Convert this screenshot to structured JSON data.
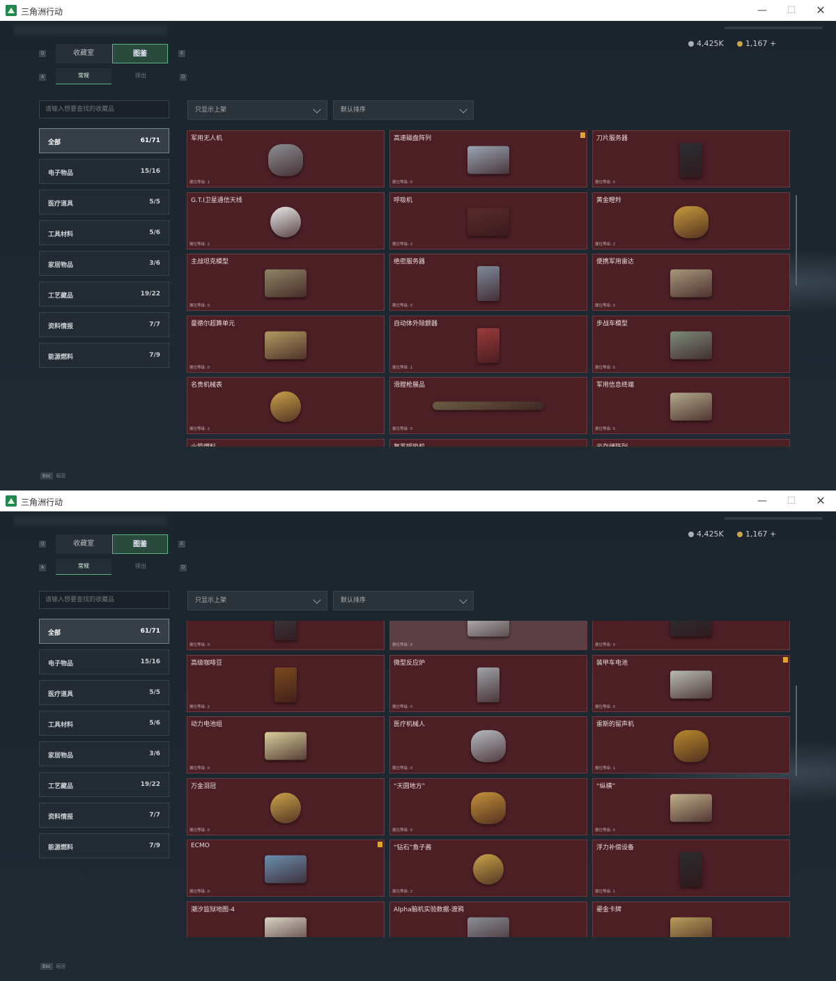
{
  "windows": [
    {
      "title": "三角洲行动",
      "controls": {
        "minimize": "—",
        "maximize": "☐",
        "close": "✕"
      },
      "currency": {
        "silver": "4,425K",
        "gold": "1,167 +"
      },
      "tabs": [
        "收藏室",
        "图鉴"
      ],
      "subtabs": [
        "常规",
        "排出"
      ],
      "search_placeholder": "请输入想要查找的收藏品",
      "filter": "只显示上架",
      "sort": "默认排序",
      "categories": [
        {
          "label": "全部",
          "count": "61/71"
        },
        {
          "label": "电子物品",
          "count": "15/16"
        },
        {
          "label": "医疗道具",
          "count": "5/5"
        },
        {
          "label": "工具材料",
          "count": "5/6"
        },
        {
          "label": "家居物品",
          "count": "3/6"
        },
        {
          "label": "工艺藏品",
          "count": "19/22"
        },
        {
          "label": "资料情报",
          "count": "7/7"
        },
        {
          "label": "能源燃料",
          "count": "7/9"
        }
      ],
      "items": [
        {
          "name": "军用无人机",
          "level": "展位等级: 1",
          "icon": "drone-icon"
        },
        {
          "name": "高速磁盘阵列",
          "level": "展位等级: 0",
          "icon": "disk-array-icon",
          "badge": true
        },
        {
          "name": "刀片服务器",
          "level": "展位等级: 0",
          "icon": "server-icon"
        },
        {
          "name": "G.T.I卫星通信天线",
          "level": "展位等级: 2",
          "icon": "satellite-dish-icon"
        },
        {
          "name": "呼吸机",
          "level": "展位等级: 2",
          "icon": "ventilator-icon"
        },
        {
          "name": "黄金瞪羚",
          "level": "展位等级: 2",
          "icon": "gold-gazelle-icon"
        },
        {
          "name": "主战坦克模型",
          "level": "展位等级: 0",
          "icon": "tank-model-icon"
        },
        {
          "name": "绝密服务器",
          "level": "展位等级: 0",
          "icon": "secret-server-icon"
        },
        {
          "name": "便携军用雷达",
          "level": "展位等级: 0",
          "icon": "radar-icon"
        },
        {
          "name": "曼德尔超算单元",
          "level": "展位等级: 0",
          "icon": "supercomputer-unit-icon"
        },
        {
          "name": "自动体外除颤器",
          "level": "展位等级: 1",
          "icon": "defibrillator-icon"
        },
        {
          "name": "步战车模型",
          "level": "展位等级: 0",
          "icon": "ifv-model-icon"
        },
        {
          "name": "名贵机械表",
          "level": "展位等级: 2",
          "icon": "watch-icon"
        },
        {
          "name": "滑膛枪展品",
          "level": "展位等级: 0",
          "icon": "musket-icon"
        },
        {
          "name": "军用信息终端",
          "level": "展位等级: 0",
          "icon": "military-terminal-icon"
        },
        {
          "name": "火箭燃料",
          "level": "",
          "icon": "fuel-icon"
        },
        {
          "name": "复苏呼吸机",
          "level": "",
          "icon": "resuscitator-icon"
        },
        {
          "name": "云存储阵列",
          "level": "",
          "icon": "cloud-storage-icon"
        }
      ],
      "esc": {
        "key": "Esc",
        "label": "返回"
      }
    },
    {
      "title": "三角洲行动",
      "controls": {
        "minimize": "—",
        "maximize": "☐",
        "close": "✕"
      },
      "currency": {
        "silver": "4,425K",
        "gold": "1,167 +"
      },
      "tabs": [
        "收藏室",
        "图鉴"
      ],
      "subtabs": [
        "常规",
        "排出"
      ],
      "search_placeholder": "请输入想要查找的收藏品",
      "filter": "只显示上架",
      "sort": "默认排序",
      "categories": [
        {
          "label": "全部",
          "count": "61/71"
        },
        {
          "label": "电子物品",
          "count": "15/16"
        },
        {
          "label": "医疗道具",
          "count": "5/5"
        },
        {
          "label": "工具材料",
          "count": "5/6"
        },
        {
          "label": "家居物品",
          "count": "3/6"
        },
        {
          "label": "工艺藏品",
          "count": "19/22"
        },
        {
          "label": "资料情报",
          "count": "7/7"
        },
        {
          "label": "能源燃料",
          "count": "7/9"
        }
      ],
      "items": [
        {
          "name": "",
          "level": "展位等级: 0",
          "icon": "fuel-can-icon"
        },
        {
          "name": "",
          "level": "展位等级: 0",
          "icon": "terminal-icon",
          "hl": true
        },
        {
          "name": "",
          "level": "展位等级: 0",
          "icon": "storage-module-icon"
        },
        {
          "name": "高级咖啡豆",
          "level": "展位等级: 2",
          "icon": "coffee-bag-icon"
        },
        {
          "name": "微型反应炉",
          "level": "展位等级: 0",
          "icon": "reactor-icon"
        },
        {
          "name": "装甲车电池",
          "level": "展位等级: 0",
          "icon": "battery-box-icon",
          "badge": true
        },
        {
          "name": "动力电池组",
          "level": "展位等级: 0",
          "icon": "battery-pack-icon"
        },
        {
          "name": "医疗机械人",
          "level": "展位等级: 0",
          "icon": "medical-robot-icon"
        },
        {
          "name": "雷斯的留声机",
          "level": "展位等级: 1",
          "icon": "gramophone-icon"
        },
        {
          "name": "万金泪冠",
          "level": "展位等级: 0",
          "icon": "jeweled-egg-icon"
        },
        {
          "name": "“天圆地方”",
          "level": "展位等级: 0",
          "icon": "armillary-icon"
        },
        {
          "name": "“纵横”",
          "level": "展位等级: 0",
          "icon": "chess-box-icon"
        },
        {
          "name": "ECMO",
          "level": "展位等级: 0",
          "icon": "ecmo-icon",
          "badge": true
        },
        {
          "name": "“钻石”鱼子酱",
          "level": "展位等级: 2",
          "icon": "caviar-tin-icon"
        },
        {
          "name": "浮力补偿设备",
          "level": "展位等级: 1",
          "icon": "bcd-icon"
        },
        {
          "name": "潮汐监狱地图-4",
          "level": "",
          "icon": "map-icon"
        },
        {
          "name": "Alpha脑机实验数据-渡鸦",
          "level": "",
          "icon": "data-icon"
        },
        {
          "name": "鎏金卡牌",
          "level": "",
          "icon": "card-icon"
        }
      ],
      "esc": {
        "key": "Esc",
        "label": "返回"
      }
    }
  ]
}
